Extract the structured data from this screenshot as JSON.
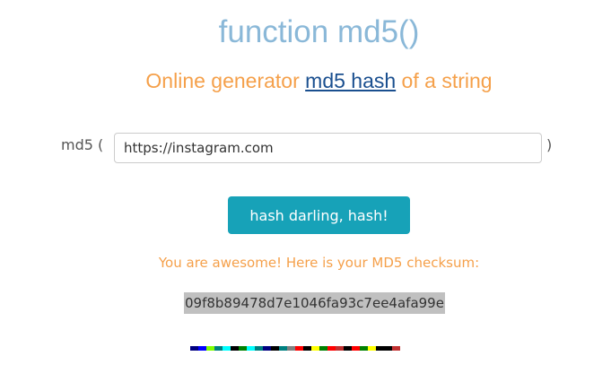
{
  "header": {
    "title": "function md5()",
    "subtitle_before": "Online generator ",
    "subtitle_link": "md5 hash",
    "subtitle_after": " of a string"
  },
  "form": {
    "prefix": "md5 (",
    "suffix": ")",
    "input_value": "https://instagram.com",
    "button_label": "hash darling, hash!"
  },
  "result": {
    "message": "You are awesome! Here is your MD5 checksum:",
    "hash": "09f8b89478d7e1046fa93c7ee4afa99e"
  },
  "colors": {
    "title": "#8ab8d8",
    "accent_orange": "#f5a04a",
    "link_blue": "#1a4f8f",
    "button_bg": "#17a2b8",
    "label_text": "#555555",
    "hash_highlight": "#c0c0c0"
  },
  "hash_strip": [
    "#000080",
    "#0000ff",
    "#80ff00",
    "#008080",
    "#00ffff",
    "#000000",
    "#008000",
    "#00ffff",
    "#008080",
    "#000080",
    "#000000",
    "#008080",
    "#808080",
    "#ff0000",
    "#000000",
    "#ffff00",
    "#008000",
    "#ff0000",
    "#c03030",
    "#000000",
    "#ff0000",
    "#008000",
    "#ffff00",
    "#000000",
    "#000000",
    "#c03030"
  ]
}
